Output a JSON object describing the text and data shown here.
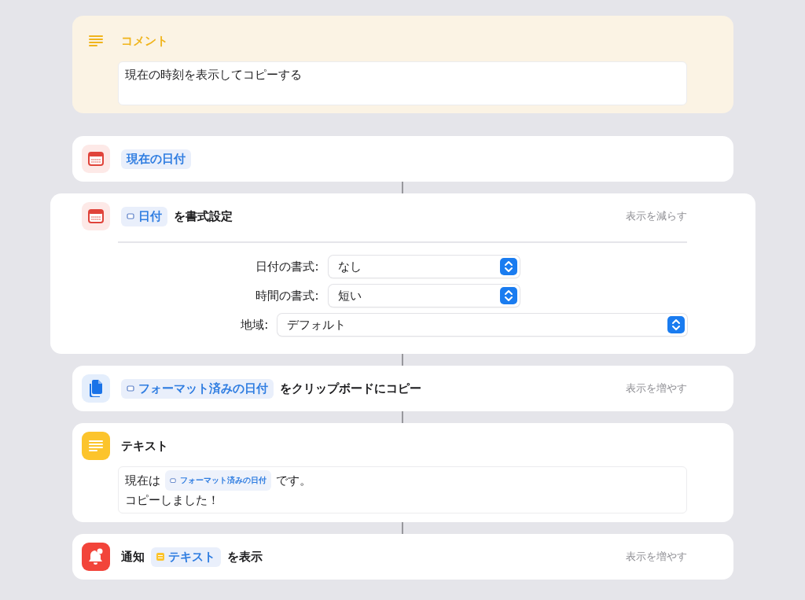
{
  "actions": [
    {
      "kind": "comment",
      "expanded": false,
      "header": [
        {
          "kind": "text",
          "text": "コメント"
        }
      ],
      "body_lines": [
        [
          {
            "kind": "text",
            "text": "現在の時刻を表示してコピーする"
          }
        ]
      ]
    },
    {
      "kind": "calendar",
      "expanded": false,
      "header": [
        {
          "kind": "variable",
          "text": "現在の日付"
        }
      ]
    },
    {
      "kind": "calendar",
      "expanded": true,
      "toggle": "表示を減らす",
      "header": [
        {
          "kind": "date_variable",
          "text": "日付"
        },
        {
          "kind": "text",
          "text": "を書式設定"
        }
      ],
      "fields": [
        {
          "label": "日付の書式:",
          "value": "なし"
        },
        {
          "label": "時間の書式:",
          "value": "短い"
        },
        {
          "label": "地域:",
          "value": "デフォルト"
        }
      ]
    },
    {
      "kind": "clipboard",
      "expanded": false,
      "toggle": "表示を増やす",
      "header": [
        {
          "kind": "date_variable",
          "text": "フォーマット済みの日付"
        },
        {
          "kind": "text",
          "text": "をクリップボードにコピー"
        }
      ]
    },
    {
      "kind": "text",
      "expanded": false,
      "header": [
        {
          "kind": "text",
          "text": "テキスト"
        }
      ],
      "body_lines": [
        [
          {
            "kind": "text",
            "text": "現在は"
          },
          {
            "kind": "date_variable",
            "text": "フォーマット済みの日付"
          },
          {
            "kind": "text",
            "text": "です。"
          }
        ],
        [
          {
            "kind": "text",
            "text": "コピーしました！"
          }
        ]
      ]
    },
    {
      "kind": "notification",
      "expanded": false,
      "toggle": "表示を増やす",
      "header": [
        {
          "kind": "text",
          "text": "通知"
        },
        {
          "kind": "text_variable",
          "text": "テキスト"
        },
        {
          "kind": "text",
          "text": "を表示"
        }
      ]
    }
  ]
}
